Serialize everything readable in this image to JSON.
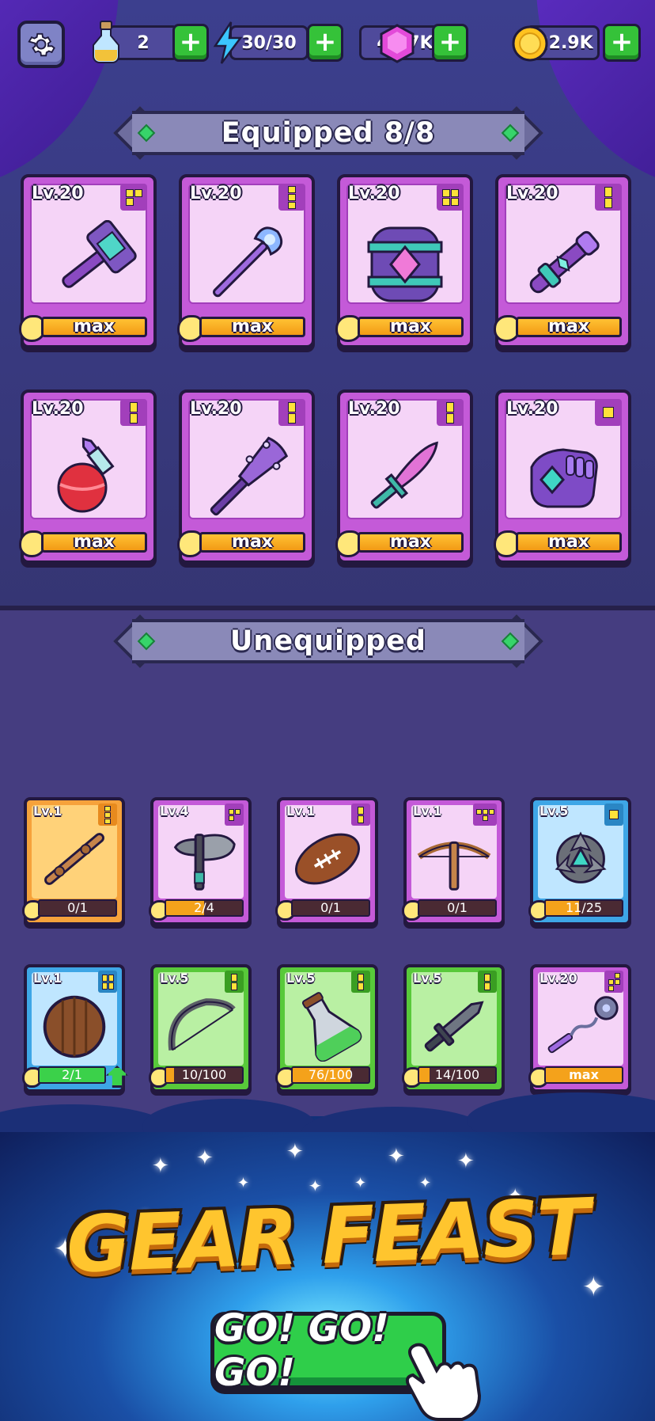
{
  "resources": {
    "potion": {
      "value": "2",
      "icon": "potion-icon"
    },
    "energy": {
      "value": "30/30",
      "icon": "lightning-icon"
    },
    "gems": {
      "value": "42.7K",
      "icon": "gem-icon"
    },
    "coins": {
      "value": "22.9K",
      "icon": "coin-icon"
    }
  },
  "equipped": {
    "title": "Equipped 8/8",
    "items": [
      {
        "level": "Lv.20",
        "status": "max",
        "icon": "hammer-icon"
      },
      {
        "level": "Lv.20",
        "status": "max",
        "icon": "staff-icon"
      },
      {
        "level": "Lv.20",
        "status": "max",
        "icon": "barrel-icon"
      },
      {
        "level": "Lv.20",
        "status": "max",
        "icon": "scepter-icon"
      },
      {
        "level": "Lv.20",
        "status": "max",
        "icon": "potion-bottle-icon"
      },
      {
        "level": "Lv.20",
        "status": "max",
        "icon": "spiked-club-icon"
      },
      {
        "level": "Lv.20",
        "status": "max",
        "icon": "curved-blade-icon"
      },
      {
        "level": "Lv.20",
        "status": "max",
        "icon": "gauntlet-icon"
      }
    ]
  },
  "unequipped": {
    "title": "Unequipped",
    "items": [
      {
        "level": "Lv.1",
        "progress": "0/1",
        "icon": "wooden-stick-icon"
      },
      {
        "level": "Lv.4",
        "progress": "2/4",
        "icon": "axe-icon"
      },
      {
        "level": "Lv.1",
        "progress": "0/1",
        "icon": "football-icon"
      },
      {
        "level": "Lv.1",
        "progress": "0/1",
        "icon": "crossbow-icon"
      },
      {
        "level": "Lv.5",
        "progress": "11/25",
        "icon": "shuriken-icon"
      },
      {
        "level": "Lv.1",
        "progress": "2/1",
        "icon": "wooden-shield-icon"
      },
      {
        "level": "Lv.5",
        "progress": "10/100",
        "icon": "bow-icon"
      },
      {
        "level": "Lv.5",
        "progress": "76/100",
        "icon": "flask-icon"
      },
      {
        "level": "Lv.5",
        "progress": "14/100",
        "icon": "short-sword-icon"
      },
      {
        "level": "Lv.20",
        "progress": "max",
        "icon": "flail-icon"
      }
    ]
  },
  "promo": {
    "title": "GEAR FEAST",
    "button": "GO! GO! GO!"
  },
  "colors": {
    "equipped_card": "#c45ad8",
    "card_orange": "#f6b13d",
    "card_pink": "#c45ad8",
    "card_blue": "#3ea6e6",
    "card_green": "#58c93a",
    "progress_fill": "#f4a21b",
    "plus_button": "#35c239"
  }
}
